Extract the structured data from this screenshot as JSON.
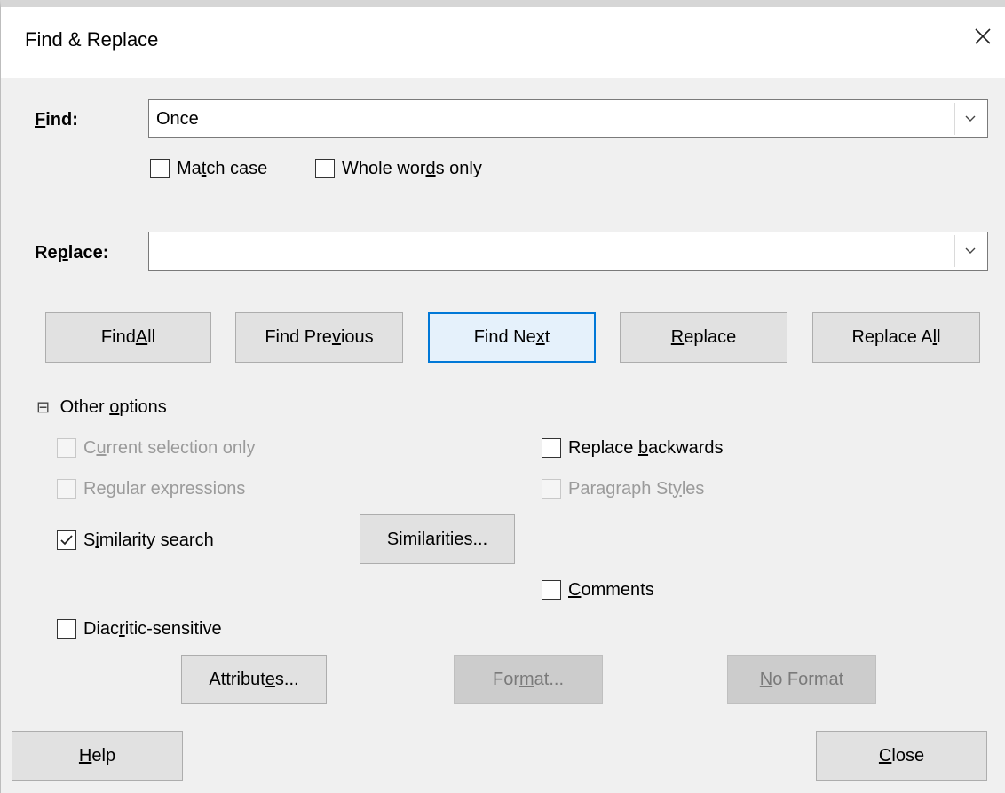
{
  "window": {
    "title": "Find & Replace"
  },
  "find": {
    "label_pre": "",
    "label_u": "F",
    "label_post": "ind:",
    "value": "Once",
    "match_case": {
      "pre": "Ma",
      "u": "t",
      "post": "ch case",
      "checked": false
    },
    "whole_words": {
      "pre": "Whole wor",
      "u": "d",
      "post": "s only",
      "checked": false
    }
  },
  "replace": {
    "label_pre": "Re",
    "label_u": "p",
    "label_post": "lace:",
    "value": ""
  },
  "buttons": {
    "find_all": {
      "pre": "Find ",
      "u": "A",
      "post": "ll"
    },
    "find_previous": {
      "pre": "Find Pre",
      "u": "v",
      "post": "ious"
    },
    "find_next": {
      "pre": "Find Ne",
      "u": "x",
      "post": "t"
    },
    "replace": {
      "pre": "",
      "u": "R",
      "post": "eplace"
    },
    "replace_all": {
      "pre": "Replace A",
      "u": "l",
      "post": "l"
    }
  },
  "other_options": {
    "toggle_symbol": "⊟",
    "label_pre": "Other ",
    "label_u": "o",
    "label_post": "ptions",
    "current_selection": {
      "pre": "C",
      "u": "u",
      "post": "rrent selection only",
      "checked": false,
      "disabled": true
    },
    "regular_expressions": {
      "pre": "Re",
      "u": "g",
      "post": "ular expressions",
      "checked": false,
      "disabled": true
    },
    "similarity_search": {
      "pre": "S",
      "u": "i",
      "post": "milarity search",
      "checked": true,
      "disabled": false
    },
    "similarities_button": {
      "pre": "Similarities...",
      "u": "",
      "post": ""
    },
    "replace_backwards": {
      "pre": "Replace ",
      "u": "b",
      "post": "ackwards",
      "checked": false,
      "disabled": false
    },
    "paragraph_styles": {
      "pre": "Paragraph St",
      "u": "y",
      "post": "les",
      "checked": false,
      "disabled": true
    },
    "comments": {
      "pre": "",
      "u": "C",
      "post": "omments",
      "checked": false,
      "disabled": false
    },
    "diacritic_sensitive": {
      "pre": "Diac",
      "u": "r",
      "post": "itic-sensitive",
      "checked": false,
      "disabled": false
    },
    "attributes_button": {
      "pre": "Attribut",
      "u": "e",
      "post": "s..."
    },
    "format_button": {
      "pre": "For",
      "u": "m",
      "post": "at..."
    },
    "no_format_button": {
      "pre": "",
      "u": "N",
      "post": "o Format"
    }
  },
  "footer": {
    "help": {
      "pre": "",
      "u": "H",
      "post": "elp"
    },
    "close": {
      "pre": "",
      "u": "C",
      "post": "lose"
    }
  }
}
